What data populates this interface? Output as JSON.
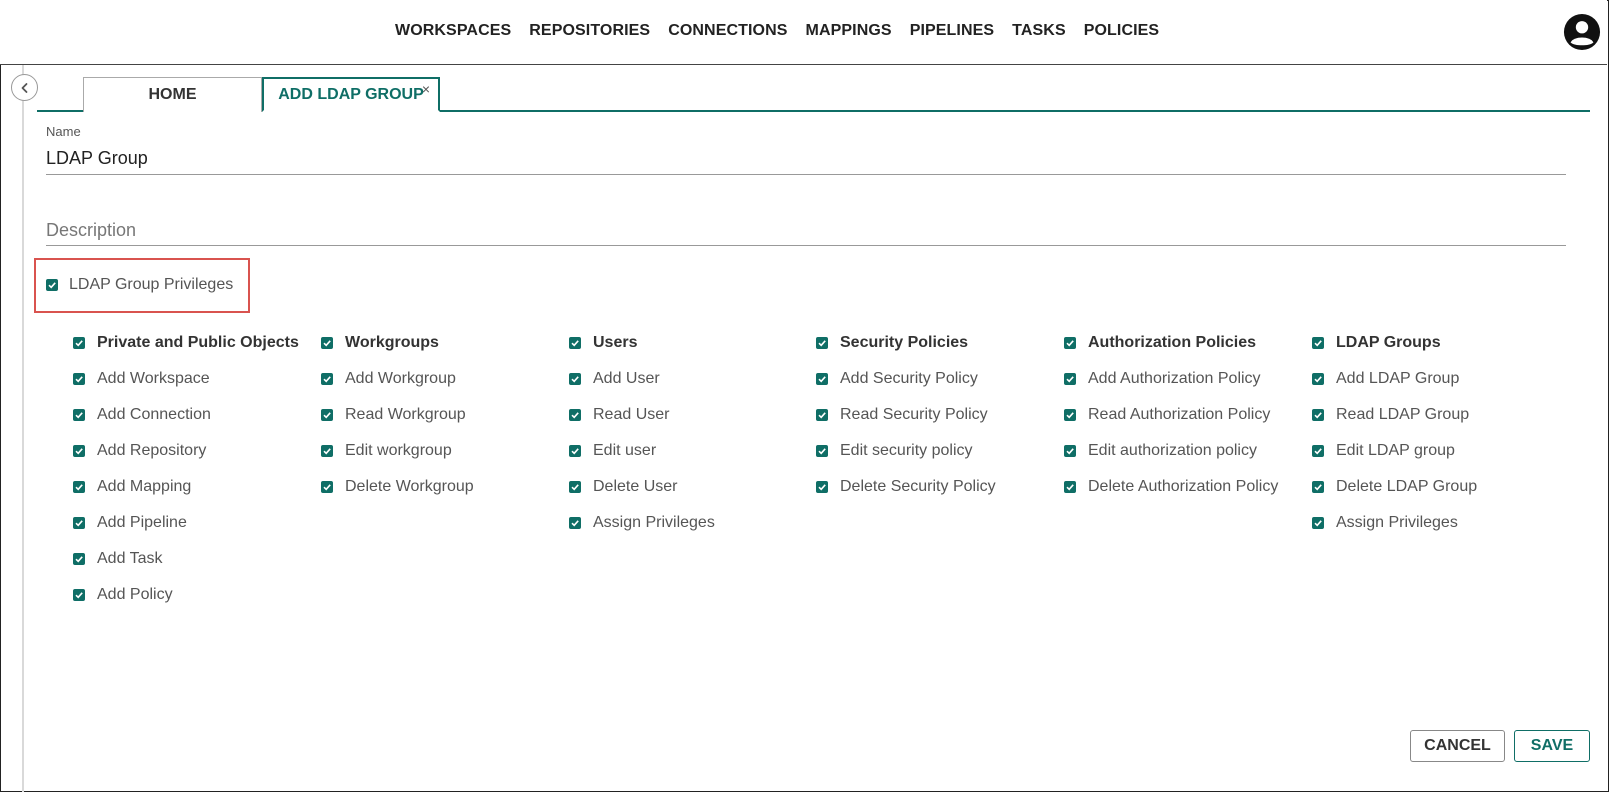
{
  "nav": {
    "items": [
      "WORKSPACES",
      "REPOSITORIES",
      "CONNECTIONS",
      "MAPPINGS",
      "PIPELINES",
      "TASKS",
      "POLICIES"
    ]
  },
  "tabs": {
    "home": "HOME",
    "active": "ADD LDAP GROUP",
    "close": "×"
  },
  "form": {
    "name_label": "Name",
    "name_value": "LDAP Group",
    "description_placeholder": "Description",
    "master_privilege": "LDAP Group Privileges"
  },
  "privilege_columns": [
    {
      "title": "Private and Public Objects",
      "items": [
        "Add Workspace",
        "Add Connection",
        "Add Repository",
        "Add Mapping",
        "Add Pipeline",
        "Add Task",
        "Add Policy"
      ]
    },
    {
      "title": "Workgroups",
      "items": [
        "Add Workgroup",
        "Read Workgroup",
        "Edit workgroup",
        "Delete Workgroup"
      ]
    },
    {
      "title": "Users",
      "items": [
        "Add User",
        "Read User",
        "Edit user",
        "Delete User",
        "Assign Privileges"
      ]
    },
    {
      "title": "Security Policies",
      "items": [
        "Add Security Policy",
        "Read Security Policy",
        "Edit security policy",
        "Delete Security Policy"
      ]
    },
    {
      "title": "Authorization Policies",
      "items": [
        "Add Authorization Policy",
        "Read Authorization Policy",
        "Edit authorization policy",
        "Delete Authorization Policy"
      ]
    },
    {
      "title": "LDAP Groups",
      "items": [
        "Add LDAP Group",
        "Read LDAP Group",
        "Edit LDAP group",
        "Delete LDAP Group",
        "Assign Privileges"
      ]
    }
  ],
  "buttons": {
    "cancel": "CANCEL",
    "save": "SAVE"
  },
  "colors": {
    "accent": "#0f6e66",
    "highlight": "#d9534f"
  },
  "icons": {
    "avatar": "account-circle-icon",
    "collapse": "chevron-left-icon",
    "checkbox": "checkbox-checked-icon"
  }
}
